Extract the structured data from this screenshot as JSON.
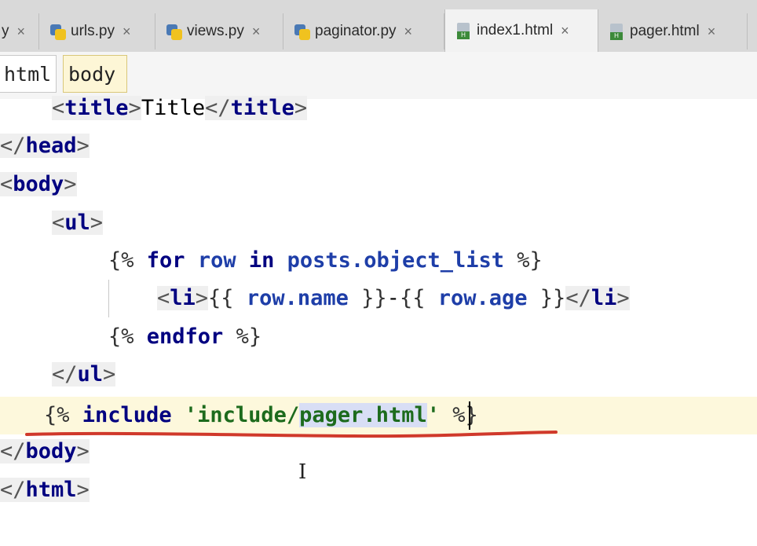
{
  "tabs": [
    {
      "label": "y",
      "icon": "none",
      "close": "×"
    },
    {
      "label": "urls.py",
      "icon": "python-file-icon",
      "close": "×"
    },
    {
      "label": "views.py",
      "icon": "python-file-icon",
      "close": "×"
    },
    {
      "label": "paginator.py",
      "icon": "python-file-icon",
      "close": "×"
    },
    {
      "label": "index1.html",
      "icon": "html-file-icon",
      "close": "×",
      "active": true
    },
    {
      "label": "pager.html",
      "icon": "html-file-icon",
      "close": "×"
    }
  ],
  "breadcrumb": [
    "html",
    "body"
  ],
  "code": {
    "l1": {
      "lt": "<",
      "tag": "title",
      "gt": ">",
      "text": "Title",
      "clt": "</",
      "ctag": "title",
      "cgt": ">"
    },
    "l2": {
      "clt": "</",
      "ctag": "head",
      "cgt": ">"
    },
    "l3": {
      "lt": "<",
      "tag": "body",
      "gt": ">"
    },
    "l4": {
      "lt": "<",
      "tag": "ul",
      "gt": ">"
    },
    "l5": {
      "open": "{%",
      "kw1": "for",
      "v1": "row",
      "kw2": "in",
      "v2": "posts.",
      "v3": "object_list",
      "close": "%}"
    },
    "l6": {
      "lt": "<",
      "tag": "li",
      "gt": ">",
      "o1": "{{",
      "v1": "row.",
      "v2": "name",
      "c1": "}}",
      "dash": "-",
      "o2": "{{",
      "v3": "row.",
      "v4": "age",
      "c2": "}}",
      "clt": "</",
      "ctag": "li",
      "cgt": ">"
    },
    "l7": {
      "open": "{%",
      "kw": "endfor",
      "close": "%}"
    },
    "l8": {
      "clt": "</",
      "ctag": "ul",
      "cgt": ">"
    },
    "l9": {
      "open": "{%",
      "kw": "include",
      "q1": "'",
      "s1": "include/",
      "s2": "pager.html",
      "q2": "'",
      "close": "%}"
    },
    "l10": {
      "clt": "</",
      "ctag": "body",
      "cgt": ">"
    },
    "l11": {
      "clt": "</",
      "ctag": "html",
      "cgt": ">"
    }
  },
  "colors": {
    "tag": "#000080",
    "string": "#1d6b1d",
    "current_line": "#fdf8dc",
    "selection": "#d8def5",
    "annotation_underline": "#d0392b"
  }
}
